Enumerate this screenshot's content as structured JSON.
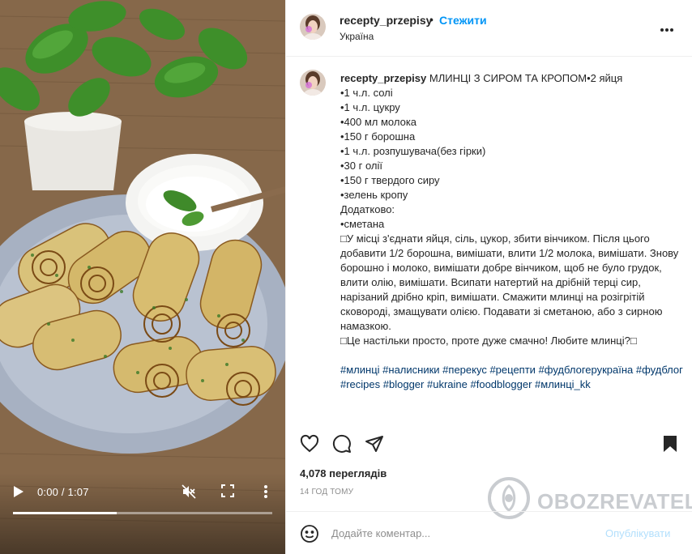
{
  "video": {
    "time": "0:00 / 1:07",
    "progress_fraction": 0.4,
    "play_icon": "play-icon",
    "mute_icon": "volume-muted-icon",
    "fullscreen_icon": "fullscreen-icon",
    "more_icon": "more-vertical-icon"
  },
  "header": {
    "username": "recepty_przepisy",
    "separator": "•",
    "follow_label": "Стежити",
    "location": "Україна",
    "more_icon": "more-horizontal-icon"
  },
  "caption": {
    "username": "recepty_przepisy",
    "title": "МЛИНЦІ З СИРОМ ТА КРОПОМ•2 яйця",
    "ingredients": [
      "•1 ч.л. солі",
      "•1 ч.л. цукру",
      "•400 мл молока",
      "•150 г борошна",
      "•1 ч.л. розпушувача(без гірки)",
      "•30 г олії",
      "•150 г твердого сиру",
      "•зелень кропу",
      "Додатково:",
      "•сметана"
    ],
    "method": "У місці з'єднати яйця, сіль, цукор, збити вінчиком. Після цього добавити 1/2 борошна, вимішати, влити 1/2 молока, вимішати. Знову борошно і молоко, вимішати добре вінчиком, щоб не було грудок, влити олію, вимішати. Всипати натертий на дрібній терці сир, нарізаний дрібно кріп, вимішати. Смажити млинці на розігрітій сковороді, змащувати олією. Подавати зі сметаною, або з сирною намазкою.",
    "closing": "Це настільки просто, проте дуже смачно! Любите млинці?",
    "hashtags": [
      "#млинці",
      "#налисники",
      "#перекус",
      "#рецепти",
      "#фудблогерукраїна",
      "#фудблог",
      "#recipes",
      "#blogger",
      "#ukraine",
      "#foodblogger",
      "#млинці_kk"
    ]
  },
  "actions": {
    "like_icon": "heart-icon",
    "comment_icon": "comment-icon",
    "share_icon": "send-icon",
    "save_icon": "bookmark-icon"
  },
  "stats": {
    "views": "4,078 переглядів",
    "posted": "14 ГОД ТОМУ"
  },
  "watermark": {
    "text": "OBOZREVATEL"
  },
  "comment": {
    "placeholder": "Додайте коментар...",
    "publish_label": "Опублікувати",
    "emoji_icon": "emoji-icon"
  },
  "colors": {
    "accent": "#0095f6",
    "hashtag": "#00376b",
    "muted": "#8e8e8e",
    "publish_disabled": "#b2dffc"
  }
}
